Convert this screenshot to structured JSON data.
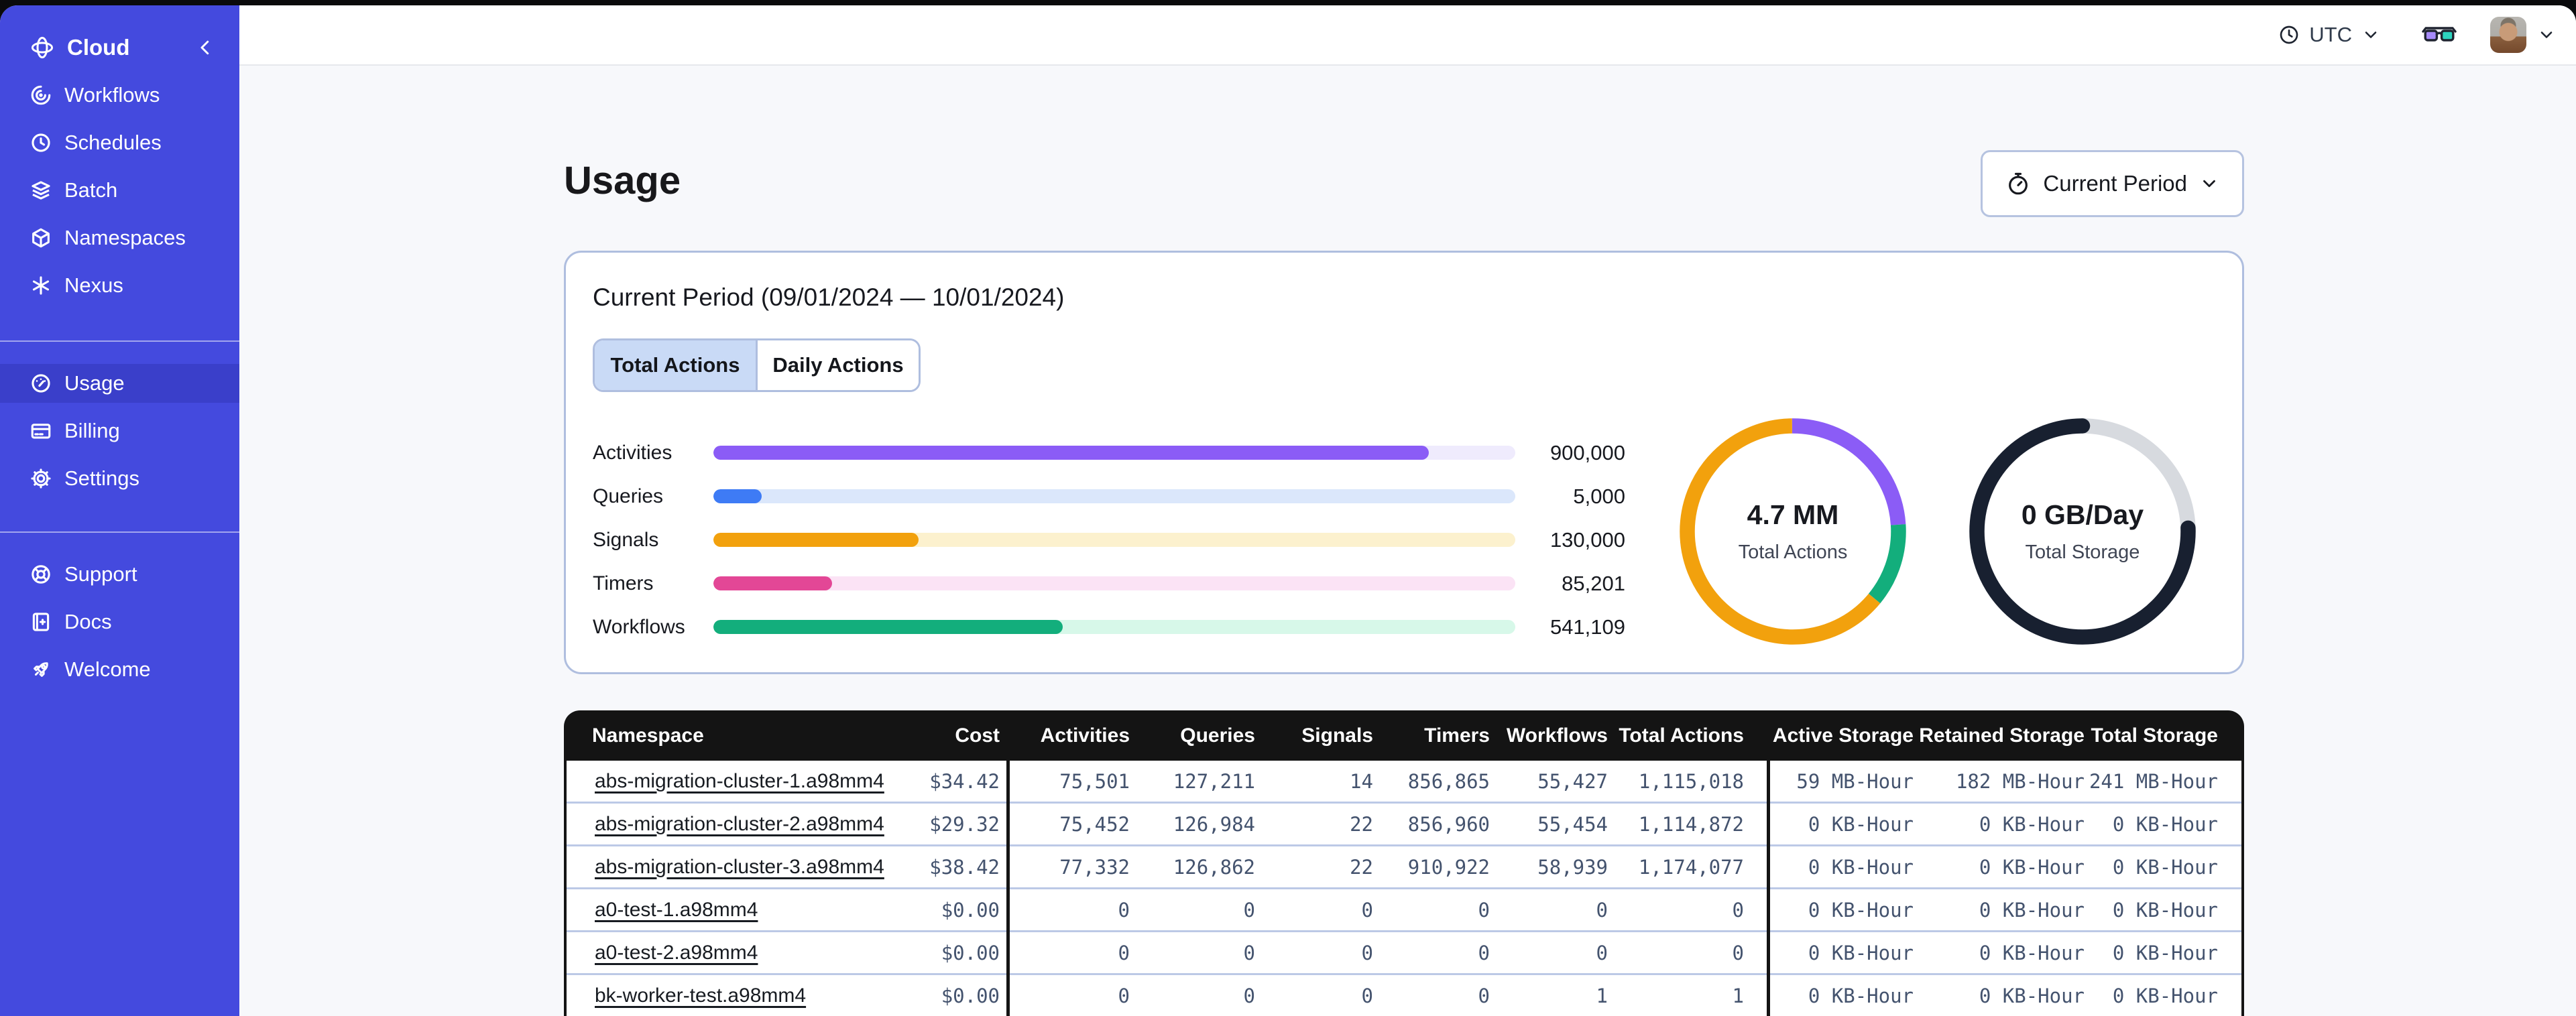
{
  "sidebar": {
    "brand": "Cloud",
    "groups": [
      {
        "items": [
          {
            "label": "Workflows"
          },
          {
            "label": "Schedules"
          },
          {
            "label": "Batch"
          },
          {
            "label": "Namespaces"
          },
          {
            "label": "Nexus"
          }
        ]
      },
      {
        "items": [
          {
            "label": "Usage"
          },
          {
            "label": "Billing"
          },
          {
            "label": "Settings"
          }
        ]
      },
      {
        "items": [
          {
            "label": "Support"
          },
          {
            "label": "Docs"
          },
          {
            "label": "Welcome"
          }
        ]
      }
    ]
  },
  "topbar": {
    "timezone_label": "UTC"
  },
  "page": {
    "title": "Usage",
    "period_button_label": "Current Period"
  },
  "card": {
    "title": "Current Period (09/01/2024 — 10/01/2024)",
    "tabs": [
      "Total Actions",
      "Daily Actions"
    ]
  },
  "chart_data": [
    {
      "type": "bar",
      "title": "Current Period (09/01/2024 — 10/01/2024)",
      "categories": [
        "Activities",
        "Queries",
        "Signals",
        "Timers",
        "Workflows"
      ],
      "values": [
        900000,
        5000,
        130000,
        85201,
        541109
      ],
      "display_values": [
        "900,000",
        "5,000",
        "130,000",
        "85,201",
        "541,109"
      ],
      "fill_pct": [
        "89.2%",
        "6%",
        "25.6%",
        "14.8%",
        "43.6%"
      ],
      "colors": [
        "#8b5cf6",
        "#3e7bf5",
        "#f2a10d",
        "#e34796",
        "#13ae7c"
      ],
      "track_colors": [
        "#efebfd",
        "#dbe7fb",
        "#fcf1ce",
        "#fbe3f5",
        "#d7f8e9"
      ],
      "legend_position": "none",
      "grid": false
    },
    {
      "type": "pie",
      "center_value": "4.7 MM",
      "center_label": "Total Actions",
      "segments": [
        {
          "name": "purple",
          "color": "#8b5cf6",
          "pct": 24,
          "dash": "24 76",
          "offset": "0"
        },
        {
          "name": "green",
          "color": "#13ae7c",
          "pct": 12,
          "dash": "12 88",
          "offset": "-24"
        },
        {
          "name": "orange",
          "color": "#f2a10d",
          "pct": 64,
          "dash": "64 36",
          "offset": "-36"
        }
      ]
    },
    {
      "type": "pie",
      "center_value": "0 GB/Day",
      "center_label": "Total Storage",
      "segments": [
        {
          "name": "gray",
          "color": "#d7dadf",
          "pct": 24.5,
          "dash": "24.5 75.5",
          "offset": "0"
        },
        {
          "name": "navy",
          "color": "#182030",
          "pct": 75.5,
          "dash": "75.5 24.5",
          "offset": "-24.5"
        }
      ]
    }
  ],
  "table": {
    "headers": [
      "Namespace",
      "Cost",
      "Activities",
      "Queries",
      "Signals",
      "Timers",
      "Workflows",
      "Total Actions",
      "Active Storage",
      "Retained Storage",
      "Total Storage"
    ],
    "rows": [
      [
        "abs-migration-cluster-1.a98mm4",
        "$34.42",
        "75,501",
        "127,211",
        "14",
        "856,865",
        "55,427",
        "1,115,018",
        "59 MB-Hour",
        "182 MB-Hour",
        "241 MB-Hour"
      ],
      [
        "abs-migration-cluster-2.a98mm4",
        "$29.32",
        "75,452",
        "126,984",
        "22",
        "856,960",
        "55,454",
        "1,114,872",
        "0 KB-Hour",
        "0 KB-Hour",
        "0 KB-Hour"
      ],
      [
        "abs-migration-cluster-3.a98mm4",
        "$38.42",
        "77,332",
        "126,862",
        "22",
        "910,922",
        "58,939",
        "1,174,077",
        "0 KB-Hour",
        "0 KB-Hour",
        "0 KB-Hour"
      ],
      [
        "a0-test-1.a98mm4",
        "$0.00",
        "0",
        "0",
        "0",
        "0",
        "0",
        "0",
        "0 KB-Hour",
        "0 KB-Hour",
        "0 KB-Hour"
      ],
      [
        "a0-test-2.a98mm4",
        "$0.00",
        "0",
        "0",
        "0",
        "0",
        "0",
        "0",
        "0 KB-Hour",
        "0 KB-Hour",
        "0 KB-Hour"
      ],
      [
        "bk-worker-test.a98mm4",
        "$0.00",
        "0",
        "0",
        "0",
        "0",
        "1",
        "1",
        "0 KB-Hour",
        "0 KB-Hour",
        "0 KB-Hour"
      ]
    ]
  }
}
